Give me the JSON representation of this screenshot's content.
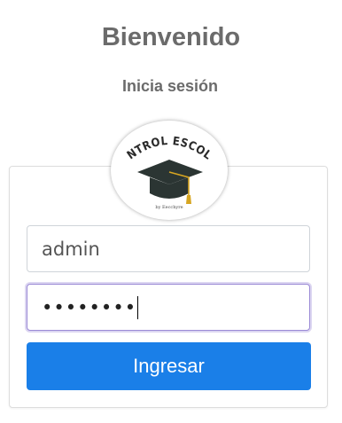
{
  "header": {
    "title": "Bienvenido",
    "subtitle": "Inicia sesión"
  },
  "logo": {
    "text": "CONTROL ESCOLAR",
    "byline": "by Eecchyre",
    "icon": "graduation-cap-icon"
  },
  "form": {
    "username_value": "admin",
    "password_mask": "••••••••",
    "submit_label": "Ingresar"
  },
  "colors": {
    "button": "#1a7fe8",
    "title_text": "#6b6b6b",
    "focus_border": "#9b8ad6"
  }
}
